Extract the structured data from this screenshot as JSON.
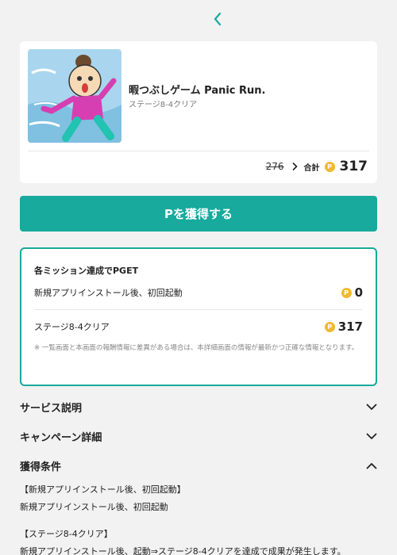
{
  "nav": {
    "back_icon": "chevron-left-icon"
  },
  "offer": {
    "title": "暇つぶしゲーム Panic Run.",
    "subtitle": "ステージ8-4クリア",
    "old_points": "276",
    "total_label": "合計",
    "coin_symbol": "P",
    "total_points": "317"
  },
  "cta": {
    "label": "Pを獲得する"
  },
  "missions": {
    "heading": "各ミッション達成でPGET",
    "items": [
      {
        "label": "新規アプリインストール後、初回起動",
        "points": "0"
      },
      {
        "label": "ステージ8-4クリア",
        "points": "317"
      }
    ],
    "note": "※ 一覧画面と本画面の報酬情報に差異がある場合は、本詳細画面の情報が最新かつ正確な情報となります。"
  },
  "sections": {
    "service": "サービス説明",
    "campaign": "キャンペーン詳細",
    "conditions": "獲得条件"
  },
  "conditions": {
    "c1_title": "【新規アプリインストール後、初回起動】",
    "c1_body": "新規アプリインストール後、初回起動",
    "c2_title": "【ステージ8-4クリア】",
    "c2_body": "新規アプリインストール後、起動⇒ステージ8-4クリアを達成で成果が発生します。"
  },
  "colors": {
    "accent": "#17aa9d",
    "coin": "#f2b833",
    "background": "#f2f2f2"
  }
}
